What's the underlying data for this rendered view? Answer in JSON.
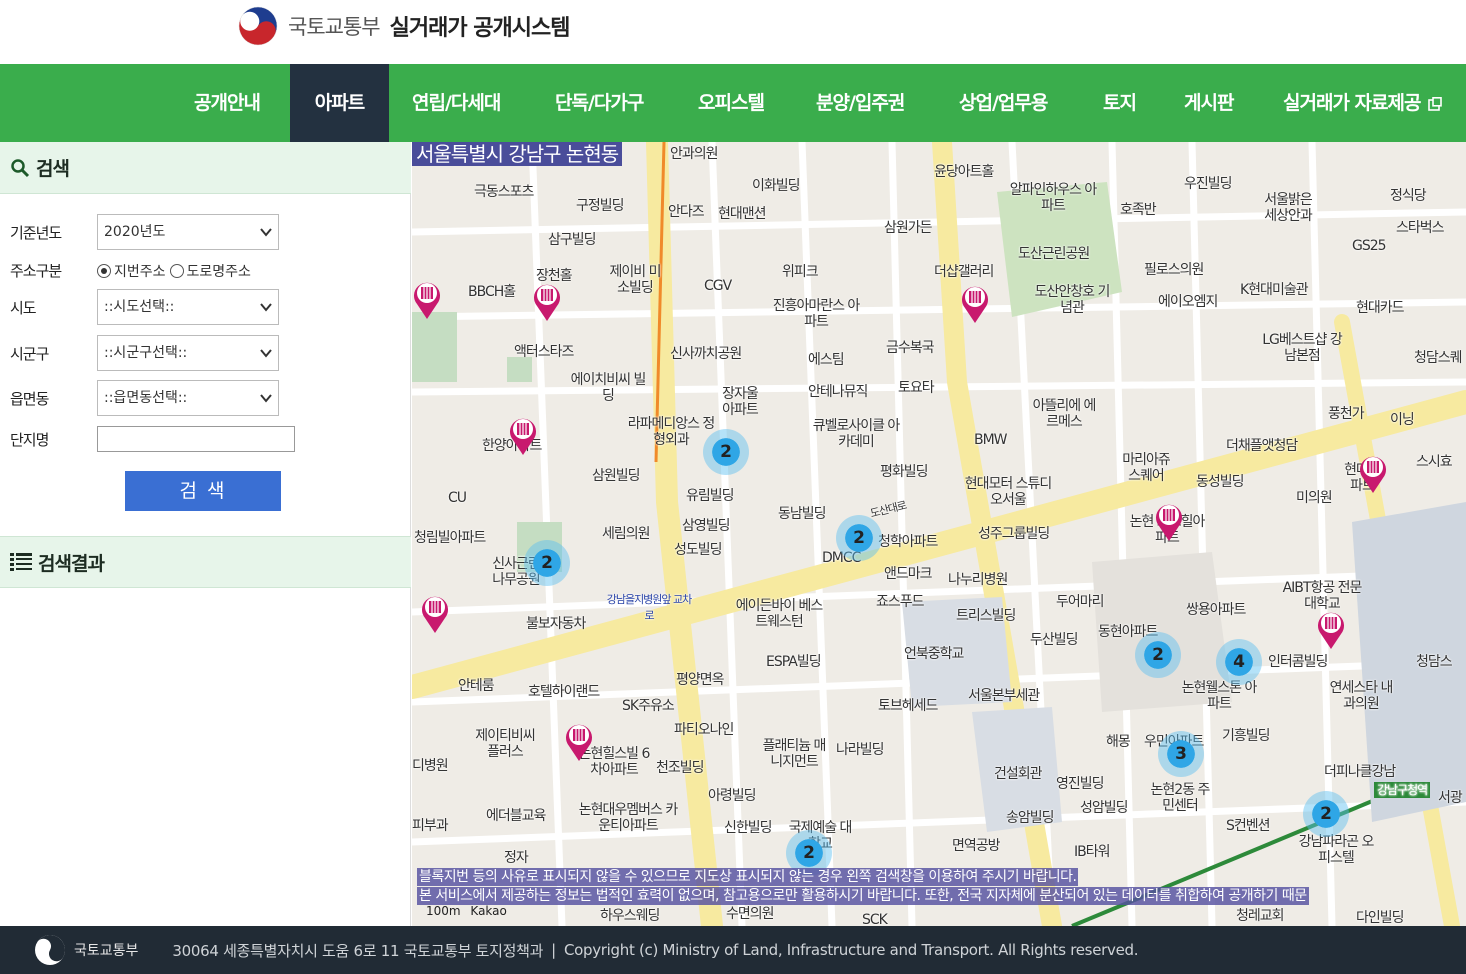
{
  "header": {
    "ministry_name": "국토교통부",
    "system_name": "실거래가 공개시스템"
  },
  "nav": {
    "items": [
      {
        "label": "공개안내",
        "active": false
      },
      {
        "label": "아파트",
        "active": true
      },
      {
        "label": "연립/다세대",
        "active": false
      },
      {
        "label": "단독/다가구",
        "active": false
      },
      {
        "label": "오피스텔",
        "active": false
      },
      {
        "label": "분양/입주권",
        "active": false
      },
      {
        "label": "상업/업무용",
        "active": false
      },
      {
        "label": "토지",
        "active": false
      },
      {
        "label": "게시판",
        "active": false
      },
      {
        "label": "실거래가 자료제공",
        "active": false,
        "icon": "external-link-icon"
      }
    ]
  },
  "search_panel": {
    "title": "검색",
    "year_label": "기준년도",
    "year_value": "2020년도",
    "address_type_label": "주소구분",
    "address_options": [
      "지번주소",
      "도로명주소"
    ],
    "address_selected": "지번주소",
    "sido_label": "시도",
    "sido_value": "::시도선택::",
    "sigungu_label": "시군구",
    "sigungu_value": "::시군구선택::",
    "dong_label": "읍면동",
    "dong_value": "::읍면동선택::",
    "complex_label": "단지명",
    "complex_value": "",
    "search_button": "검 색"
  },
  "results_panel": {
    "title": "검색결과"
  },
  "map": {
    "region_label": "서울특별시 강남구 논현동",
    "notice_1": "블록지번 등의 사유로 표시되지 않을 수 있으므로 지도상 표시되지 않는 경우 왼쪽 검색창을 이용하여 주시기 바랍니다.",
    "notice_2": "본 서비스에서 제공하는 정보는 법적인 효력이 없으며, 참고용으로만 활용하시기 바랍니다. 또한, 전국 지자체에 분산되어 있는 데이터를 취합하여 공개하기 때문",
    "scale": "100m",
    "provider": "Kakao",
    "clusters": [
      "2",
      "2",
      "2",
      "2",
      "4",
      "3",
      "2",
      "2"
    ],
    "pois": [
      "안과의원",
      "이화빌딩",
      "윤당아트홀",
      "알파인하우스 아파트",
      "호족반",
      "우진빌딩",
      "서울밝은 세상안과",
      "정식당",
      "스타벅스",
      "극동스포츠",
      "구정빌딩",
      "안다즈",
      "현대맨션",
      "삼원가든",
      "도산근린공원",
      "필로스의원",
      "GS25",
      "삼구빌딩",
      "장천홀",
      "제이비 미소빌딩",
      "위피크",
      "더샵갤러리",
      "도산안창호 기념관",
      "에이오엠지",
      "K현대미술관",
      "현대카드",
      "BBCH홀",
      "CGV",
      "진흥아마란스 아파트",
      "LG베스트샵 강남본점",
      "액터스타즈",
      "신사까치공원",
      "에스팀",
      "금수복국",
      "청담스퀘",
      "에이치비씨 빌딩",
      "장자울 아파트",
      "안테나뮤직",
      "토요타",
      "아뜰리에 에르메스",
      "풍천가",
      "이닝",
      "한양아파트",
      "라파메디앙스 정형외과",
      "큐벨로사이클 아카데미",
      "BMW",
      "마리아쥬 스퀘어",
      "더채플앳청담",
      "스시효",
      "삼원빌딩",
      "평화빌딩",
      "현대모터 스튜디오서울",
      "동성빌딩",
      "미의원",
      "현대아파트",
      "유림빌딩",
      "동남빌딩",
      "도산대로",
      "논현 로즈힐아파트",
      "청림빌아파트",
      "세림의원",
      "삼영빌딩",
      "청학아파트",
      "성주그룹빌딩",
      "성도빌딩",
      "DMCC",
      "앤드마크",
      "나누리병원",
      "신사근린 나무공원",
      "강남을지병원앞 교차로",
      "에이든바이 베스트웨스턴",
      "죠스푸드",
      "두어마리",
      "AIBT항공 전문대학교",
      "트리스빌딩",
      "불보자동차",
      "쌍용아파트",
      "ESPA빌딩",
      "언북중학교",
      "두산빌딩",
      "동현아파트",
      "인터콤빌딩",
      "청담스",
      "안테룸",
      "평양면옥",
      "호텔하이랜드",
      "토브헤세드",
      "서울본부세관",
      "논현웰스톤 아파트",
      "연세스타 내과의원",
      "SK주유소",
      "파티오나인",
      "해몽",
      "우민아파트",
      "기흥빌딩",
      "제이티비씨 플러스",
      "플래티늄 매니지먼트",
      "나라빌딩",
      "더피나클강남",
      "논현힐스빌 6차아파트",
      "천조빌딩",
      "건설회관",
      "영진빌딩",
      "강남구청역",
      "서광",
      "에더블교육",
      "논현대우멤버스 카운티아파트",
      "아령빌딩",
      "성암빌딩",
      "논현2동 주민센터",
      "S컨벤션",
      "강남파라곤 오피스텔",
      "신한빌딩",
      "국제예술 대학교",
      "송암빌딩",
      "면역공방",
      "IB타워",
      "정자",
      "하우스웨딩",
      "수면의원",
      "SCK",
      "청레교회",
      "다인빌딩",
      "CU",
      "디병원",
      "피부과"
    ]
  },
  "footer": {
    "ministry_name": "국토교통부",
    "address": "30064 세종특별자치시 도움 6로 11 국토교통부 토지정책과",
    "copyright": "Copyright (c) Ministry of Land, Infrastructure and Transport. All Rights reserved."
  },
  "colors": {
    "nav_bg": "#3aad4c",
    "nav_active_bg": "#233140",
    "panel_head_bg": "#e7f5ea",
    "search_button_bg": "#3a6fd3",
    "cluster": "#2fa6e6",
    "pin": "#c8196e",
    "footer_bg": "#212b35"
  }
}
